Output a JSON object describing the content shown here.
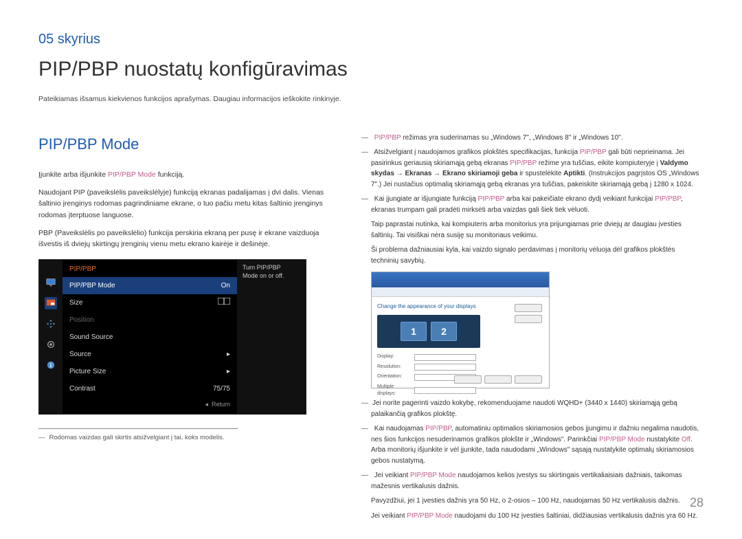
{
  "chapter": {
    "label": "05 skyrius",
    "title": "PIP/PBP nuostatų konfigūravimas",
    "desc": "Pateikiamas išsamus kiekvienos funkcijos aprašymas. Daugiau informacijos ieškokite rinkinyje."
  },
  "section": {
    "title": "PIP/PBP Mode",
    "p1_a": "Įjunkite arba išjunkite ",
    "p1_b": "PIP/PBP Mode",
    "p1_c": " funkciją.",
    "p2": "Naudojant PIP (paveikslėlis paveikslėlyje) funkciją ekranas padalijamas į dvi dalis. Vienas šaltinio įrenginys rodomas pagrindiniame ekrane, o tuo pačiu metu kitas šaltinio įrenginys rodomas įterptuose languose.",
    "p3": "PBP (Paveikslėlis po paveikslėlio) funkcija perskiria ekraną per pusę ir ekrane vaizduoja išvestis iš dviejų skirtingų įrenginių vienu metu ekrano kairėje ir dešinėje."
  },
  "osd": {
    "header": "PIP/PBP",
    "tip1": "Turn PIP/PBP",
    "tip2": "Mode on or off.",
    "rows": {
      "mode": {
        "label": "PIP/PBP Mode",
        "value": "On"
      },
      "size": {
        "label": "Size"
      },
      "position": {
        "label": "Position"
      },
      "sound": {
        "label": "Sound Source"
      },
      "source": {
        "label": "Source"
      },
      "picsize": {
        "label": "Picture Size"
      },
      "contrast": {
        "label": "Contrast",
        "value": "75/75"
      }
    },
    "return": "Return"
  },
  "left_footnote": "Rodomas vaizdas gali skirtis atsižvelgiant į tai, koks modelis.",
  "right": {
    "i1_a": "PIP/PBP",
    "i1_b": " režimas yra suderinamas su „Windows 7\", „Windows 8\" ir „Windows 10\".",
    "i2_a": "Atsižvelgiant į naudojamos grafikos plokštės specifikacijas, funkcija ",
    "i2_b": "PIP/PBP",
    "i2_c": " gali būti neprieinama. Jei pasirinkus geriausią skiriamąją gebą ekranas ",
    "i2_d": "PIP/PBP",
    "i2_e": " režime yra tuščias, eikite kompiuteryje į ",
    "i2_f": "Valdymo skydas",
    "i2_g": " → ",
    "i2_h": "Ekranas",
    "i2_i": " → ",
    "i2_j": "Ekrano skiriamoji geba",
    "i2_k": " ir spustelėkite ",
    "i2_l": "Aptikti",
    "i2_m": ". (Instrukcijos pagrįstos OS „Windows 7\".) Jei nustačius optimalią skiriamąją gebą ekranas yra tuščias, pakeiskite skiriamąją gebą į 1280 x 1024.",
    "i3_a": "Kai įjungiate ar išjungiate funkciją ",
    "i3_b": "PIP/PBP",
    "i3_c": " arba kai pakeičiate ekrano dydį veikiant funkcijai ",
    "i3_d": "PIP/PBP",
    "i3_e": ", ekranas trumpam gali pradėti mirksėti arba vaizdas gali šiek tiek vėluoti.",
    "i3_s1": "Taip paprastai nutinka, kai kompiuteris arba monitorius yra prijungiamas prie dviejų ar daugiau įvesties šaltinių. Tai visiškai nėra susiję su monitoriaus veikimu.",
    "i3_s2": "Ši problema dažniausiai kyla, kai vaizdo signalo perdavimas į monitorių vėluoja dėl grafikos plokštės techninių savybių.",
    "win_heading": "Change the appearance of your displays",
    "mon1": "1",
    "mon2": "2",
    "i4": "Jei norite pagerinti vaizdo kokybę, rekomenduojame naudoti WQHD+ (3440 x 1440) skiriamąją gebą palaikančią grafikos plokštę.",
    "i5_a": "Kai naudojamas ",
    "i5_b": "PIP/PBP",
    "i5_c": ", automatiniu optimalios skiriamosios gebos įjungimu ir dažniu negalima naudotis, nes šios funkcijos nesuderinamos grafikos plokšte ir „Windows\". Parinkčiai ",
    "i5_d": "PIP/PBP Mode",
    "i5_e": " nustatykite ",
    "i5_f": "Off",
    "i5_g": ". Arba monitorių išjunkite ir vėl įjunkite, tada naudodami „Windows\" sąsają nustatykite optimalų skiriamosios gebos nustatymą.",
    "i6_a": "Jei veikiant ",
    "i6_b": "PIP/PBP Mode",
    "i6_c": " naudojamos kelios įvestys su skirtingais vertikaliaisiais dažniais, taikomas mažesnis vertikalusis dažnis.",
    "i6_s1": "Pavyzdžiui, jei 1 įvesties dažnis yra 50 Hz, o 2-osios – 100 Hz, naudojamas 50 Hz vertikalusis dažnis.",
    "i6_s2_a": "Jei veikiant ",
    "i6_s2_b": "PIP/PBP Mode",
    "i6_s2_c": " naudojami du 100 Hz įvesties šaltiniai, didžiausias vertikalusis dažnis yra 60 Hz."
  },
  "page_num": "28"
}
